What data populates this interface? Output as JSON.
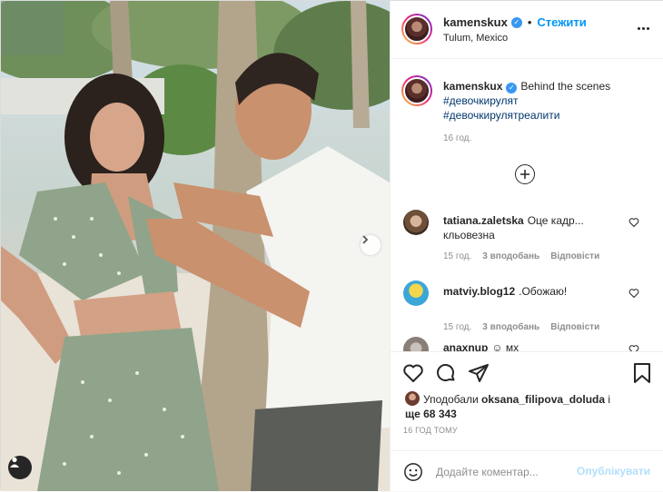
{
  "post": {
    "username": "kamenskux",
    "follow_label": "Стежити",
    "location": "Tulum, Mexico",
    "more_icon": "more-options-icon"
  },
  "caption": {
    "username": "kamenskux",
    "text": "Behind the scenes",
    "hashtags": [
      "#девочкирулят",
      "#девочкирулятреалити"
    ],
    "time": "16 год."
  },
  "comments": [
    {
      "username": "tatiana.zaletska",
      "text": "Оце кадр... кльовезна",
      "time": "15 год.",
      "likes": "3 вподобань",
      "reply": "Відповісти"
    },
    {
      "username": "matviy.blog12",
      "text": ".Обожаю!",
      "time": "15 год.",
      "likes": "3 вподобань",
      "reply": "Відповісти"
    },
    {
      "username": "anaxnup",
      "text": "☺ мх"
    }
  ],
  "likes": {
    "prefix": "Уподобали",
    "user": "oksana_filipova_doluda",
    "connector": "і",
    "suffix": "ще 68 343"
  },
  "post_time": "16 ГОД ТОМУ",
  "add_comment": {
    "placeholder": "Додайте коментар...",
    "publish_label": "Опублікувати"
  },
  "colors": {
    "link": "#0095f6",
    "hashtag": "#00376b",
    "muted": "#8e8e8e",
    "verified": "#3897f0"
  }
}
